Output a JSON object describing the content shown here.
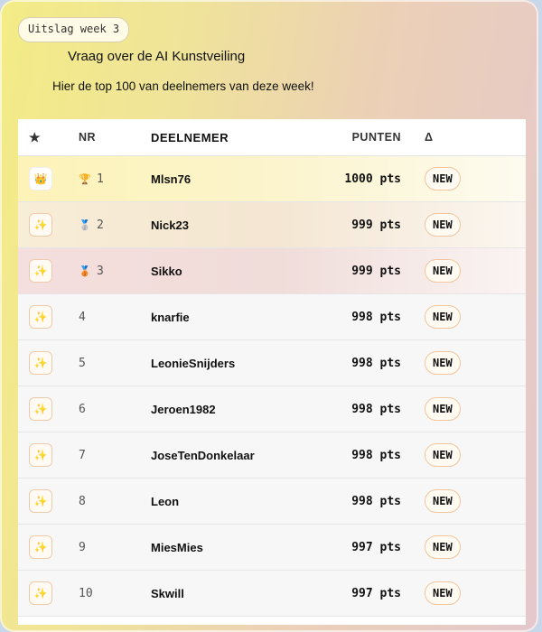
{
  "header": {
    "week_badge": "Uitslag week 3",
    "title": "Vraag over de AI Kunstveiling",
    "subtitle": "Hier de top 100 van deelnemers van deze week!"
  },
  "table": {
    "columns": {
      "star": "★",
      "nr": "NR",
      "name": "DEELNEMER",
      "points": "PUNTEN",
      "delta": "Δ"
    },
    "rows": [
      {
        "icon": "crown-icon",
        "glyph": "👑",
        "medal": "🏆",
        "nr": "1",
        "name": "Mlsn76",
        "points": "1000 pts",
        "delta": "NEW"
      },
      {
        "icon": "sparkle-icon",
        "glyph": "✨",
        "medal": "🥈",
        "nr": "2",
        "name": "Nick23",
        "points": "999 pts",
        "delta": "NEW"
      },
      {
        "icon": "sparkle-icon",
        "glyph": "✨",
        "medal": "🥉",
        "nr": "3",
        "name": "Sikko",
        "points": "999 pts",
        "delta": "NEW"
      },
      {
        "icon": "sparkle-icon",
        "glyph": "✨",
        "medal": "",
        "nr": "4",
        "name": "knarfie",
        "points": "998 pts",
        "delta": "NEW"
      },
      {
        "icon": "sparkle-icon",
        "glyph": "✨",
        "medal": "",
        "nr": "5",
        "name": "LeonieSnijders",
        "points": "998 pts",
        "delta": "NEW"
      },
      {
        "icon": "sparkle-icon",
        "glyph": "✨",
        "medal": "",
        "nr": "6",
        "name": "Jeroen1982",
        "points": "998 pts",
        "delta": "NEW"
      },
      {
        "icon": "sparkle-icon",
        "glyph": "✨",
        "medal": "",
        "nr": "7",
        "name": "JoseTenDonkelaar",
        "points": "998 pts",
        "delta": "NEW"
      },
      {
        "icon": "sparkle-icon",
        "glyph": "✨",
        "medal": "",
        "nr": "8",
        "name": "Leon",
        "points": "998 pts",
        "delta": "NEW"
      },
      {
        "icon": "sparkle-icon",
        "glyph": "✨",
        "medal": "",
        "nr": "9",
        "name": "MiesMies",
        "points": "997 pts",
        "delta": "NEW"
      },
      {
        "icon": "sparkle-icon",
        "glyph": "✨",
        "medal": "",
        "nr": "10",
        "name": "Skwill",
        "points": "997 pts",
        "delta": "NEW"
      }
    ]
  }
}
